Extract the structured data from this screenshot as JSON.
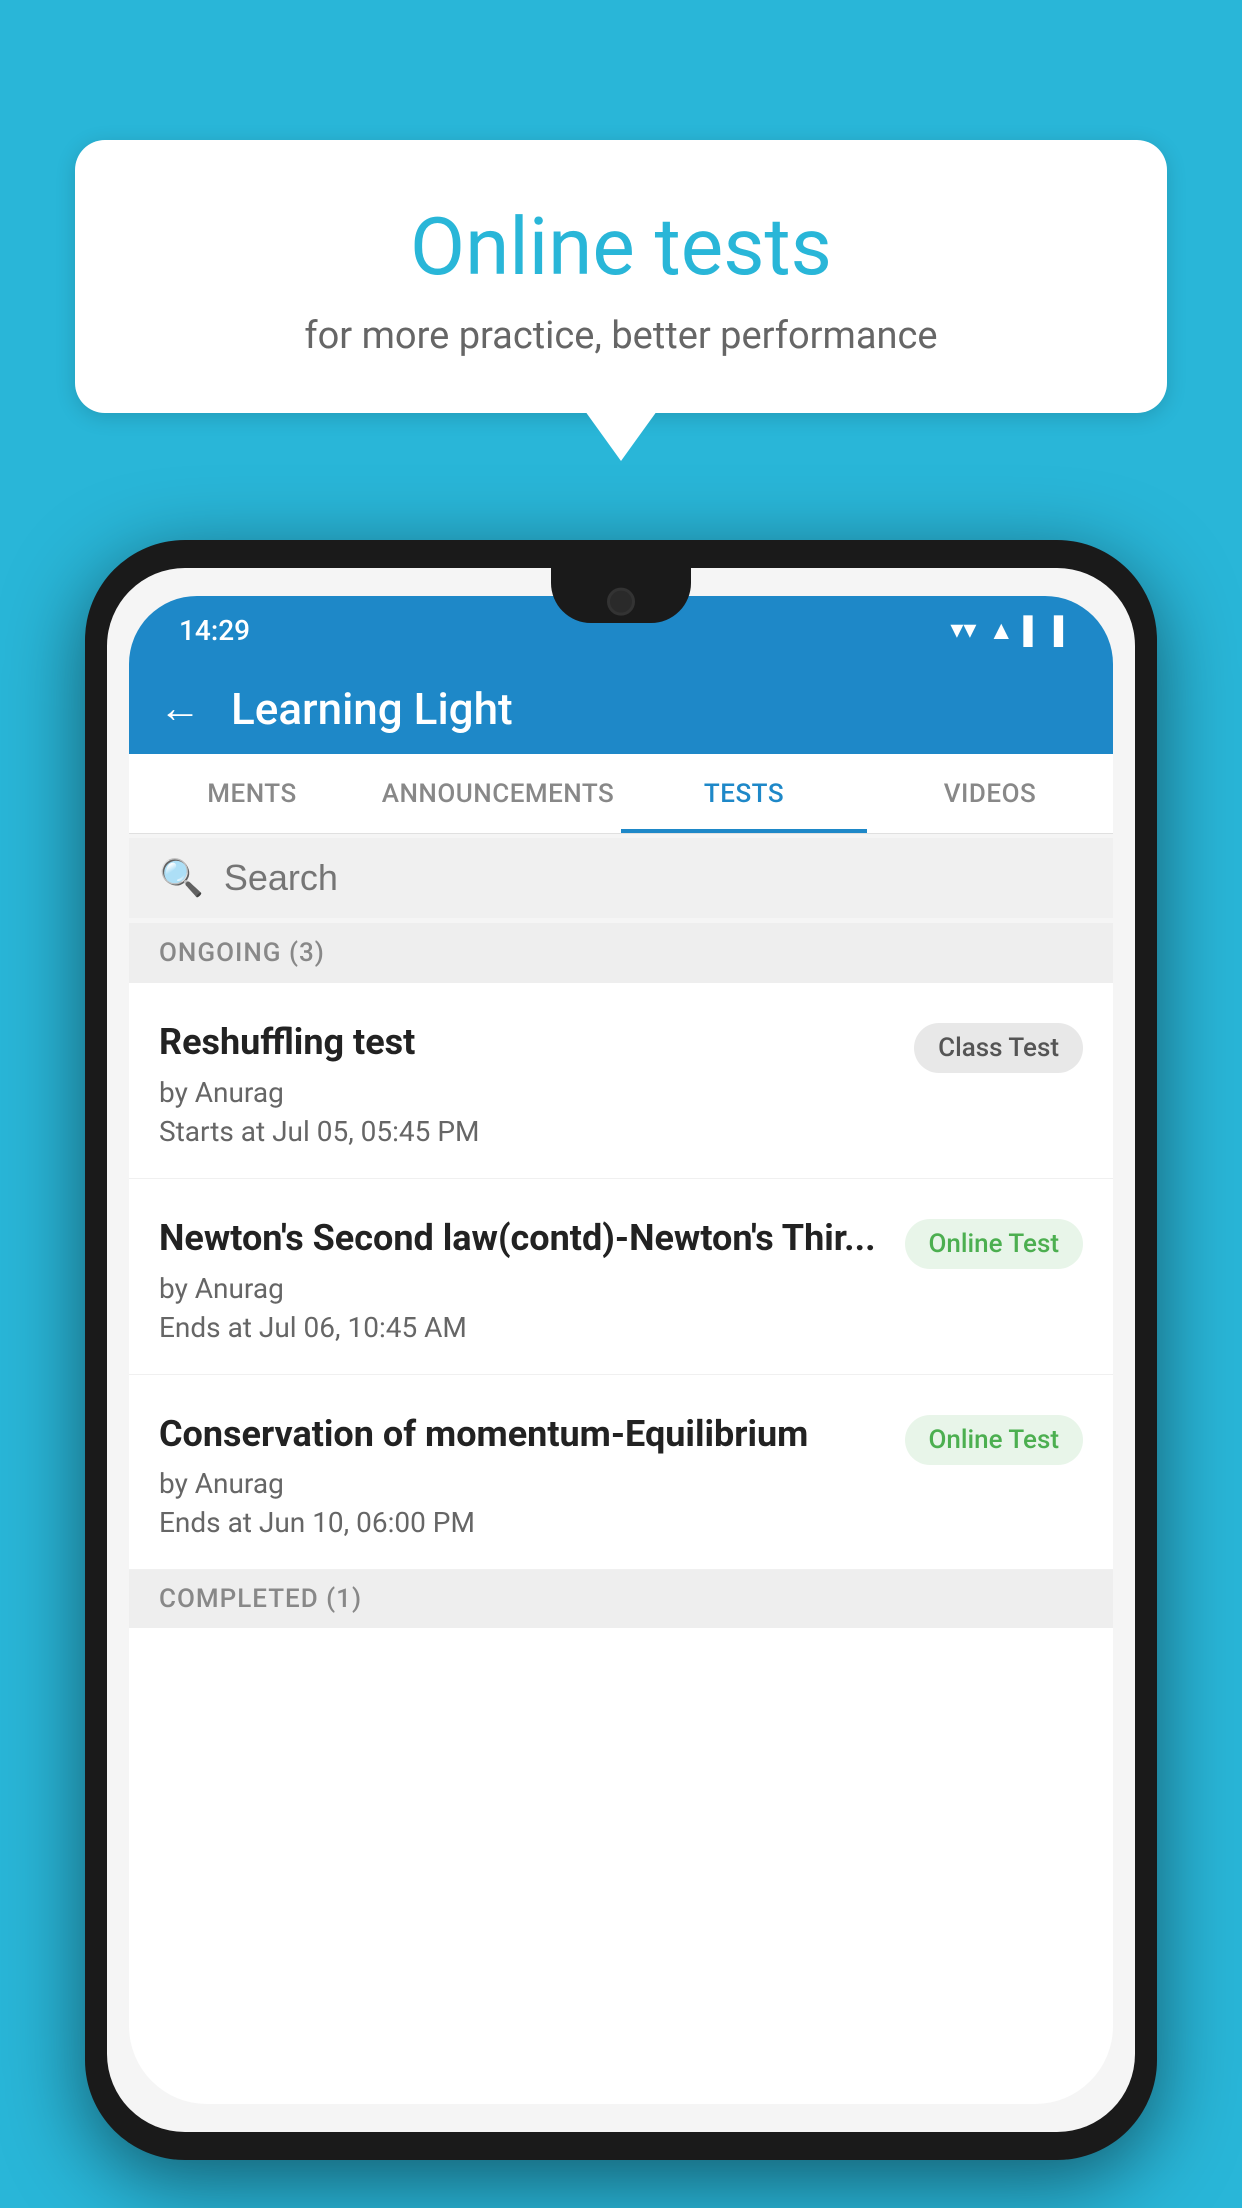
{
  "background": {
    "color": "#29b6d8"
  },
  "speech_bubble": {
    "title": "Online tests",
    "subtitle": "for more practice, better performance"
  },
  "status_bar": {
    "time": "14:29",
    "wifi": "▼",
    "signal": "▲",
    "battery": "▐"
  },
  "app_header": {
    "back_label": "←",
    "title": "Learning Light"
  },
  "tabs": [
    {
      "label": "MENTS",
      "active": false
    },
    {
      "label": "ANNOUNCEMENTS",
      "active": false
    },
    {
      "label": "TESTS",
      "active": true
    },
    {
      "label": "VIDEOS",
      "active": false
    }
  ],
  "search": {
    "placeholder": "Search"
  },
  "ongoing_section": {
    "title": "ONGOING (3)"
  },
  "tests": [
    {
      "name": "Reshuffling test",
      "author": "by Anurag",
      "time": "Starts at  Jul 05, 05:45 PM",
      "badge": "Class Test",
      "badge_type": "class"
    },
    {
      "name": "Newton's Second law(contd)-Newton's Thir...",
      "author": "by Anurag",
      "time": "Ends at  Jul 06, 10:45 AM",
      "badge": "Online Test",
      "badge_type": "online"
    },
    {
      "name": "Conservation of momentum-Equilibrium",
      "author": "by Anurag",
      "time": "Ends at  Jun 10, 06:00 PM",
      "badge": "Online Test",
      "badge_type": "online"
    }
  ],
  "completed_section": {
    "title": "COMPLETED (1)"
  }
}
